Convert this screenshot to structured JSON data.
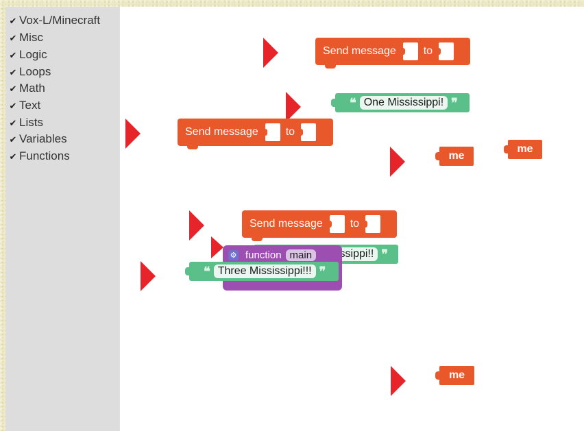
{
  "toolbox": {
    "categories": [
      {
        "label": "Vox-L/Minecraft"
      },
      {
        "label": "Misc"
      },
      {
        "label": "Logic"
      },
      {
        "label": "Loops"
      },
      {
        "label": "Math"
      },
      {
        "label": "Text"
      },
      {
        "label": "Lists"
      },
      {
        "label": "Variables"
      },
      {
        "label": "Functions"
      }
    ],
    "check_glyph": "✔"
  },
  "blocks": {
    "send_label": "Send message",
    "to_label": "to",
    "me_label": "me",
    "text_one": "One Mississippi!",
    "text_two": "ssippi!!",
    "text_three": "Three Mississippi!!!",
    "open_quote": "❝",
    "close_quote": "❞",
    "function_label": "function",
    "function_name": "main"
  },
  "colors": {
    "send_block": "#e8582b",
    "text_block": "#5bbf8a",
    "function_block": "#9c4fb1",
    "arrow": "#e8242b"
  }
}
